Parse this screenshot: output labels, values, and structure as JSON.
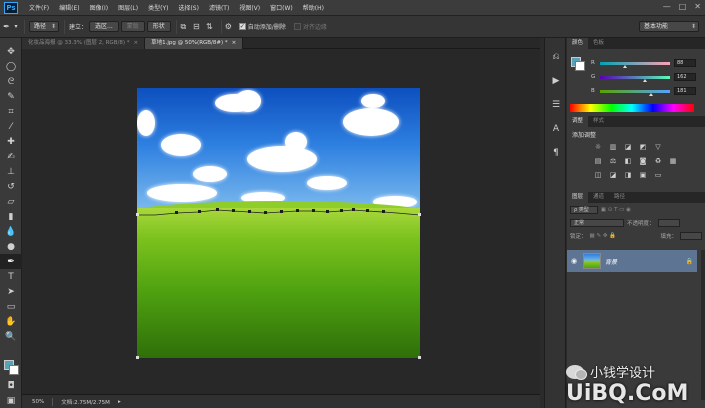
{
  "app": {
    "logo": "Ps",
    "menu": [
      "文件(F)",
      "编辑(E)",
      "图像(I)",
      "图层(L)",
      "类型(Y)",
      "选择(S)",
      "滤镜(T)",
      "视图(V)",
      "窗口(W)",
      "帮助(H)"
    ],
    "window_controls": [
      "—",
      "□",
      "✕"
    ]
  },
  "options": {
    "tool_mode": "路径",
    "make_label": "建立：",
    "selection_btn": "选区...",
    "mask_btn": "蒙版",
    "shape_btn": "形状",
    "auto_add_delete": "自动添加/删除",
    "align_edges": "对齐边缘",
    "workspace": "基本功能"
  },
  "documents": {
    "tabs": [
      {
        "title": "化妆品海报 @ 33.3% (图层 2, RGB/8) *",
        "close": "×",
        "active": false
      },
      {
        "title": "草地1.jpg @ 50%(RGB/8#) *",
        "close": "×",
        "active": true
      }
    ]
  },
  "status": {
    "zoom": "50%",
    "doc_size": "文档:2.75M/2.75M"
  },
  "colors": {
    "foreground": "#58a2b5",
    "background": "#ffffff"
  },
  "color_panel": {
    "tabs": [
      "颜色",
      "色板"
    ],
    "channels": [
      {
        "label": "R",
        "value": "88"
      },
      {
        "label": "G",
        "value": "162"
      },
      {
        "label": "B",
        "value": "181"
      }
    ]
  },
  "adjustments_panel": {
    "tabs": [
      "调整",
      "样式"
    ],
    "title": "添加调整"
  },
  "layers_panel": {
    "tabs": [
      "图层",
      "通道",
      "路径"
    ],
    "kind_label": "ρ 类型",
    "blend_mode": "正常",
    "opacity_label": "不透明度：",
    "lock_label": "锁定：",
    "fill_label": "填充：",
    "layer_name": "背景"
  },
  "tools": [
    "move-tool",
    "marquee-tool",
    "lasso-tool",
    "quick-select-tool",
    "crop-tool",
    "eyedropper-tool",
    "healing-tool",
    "brush-tool",
    "stamp-tool",
    "history-brush-tool",
    "eraser-tool",
    "gradient-tool",
    "blur-tool",
    "dodge-tool",
    "pen-tool",
    "type-tool",
    "path-select-tool",
    "rectangle-tool",
    "hand-tool",
    "zoom-tool"
  ],
  "watermark": {
    "line1": "小钱学设计",
    "line2": "UiBQ.CoM"
  }
}
